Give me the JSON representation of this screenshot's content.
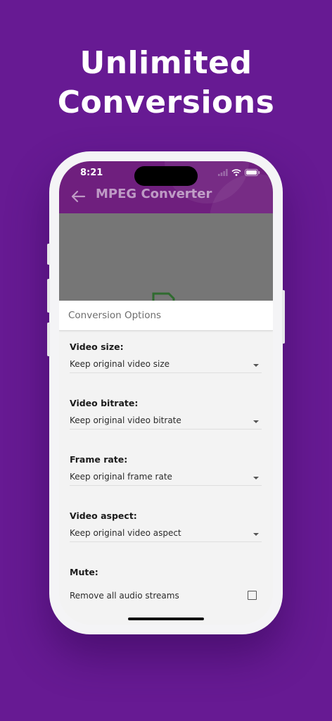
{
  "headline": {
    "line1": "Unlimited",
    "line2": "Conversions"
  },
  "status_bar": {
    "time": "8:21"
  },
  "app_bar": {
    "title": "MPEG Converter"
  },
  "sheet": {
    "title": "Conversion Options"
  },
  "options": [
    {
      "label": "Video size:",
      "value": "Keep original video size"
    },
    {
      "label": "Video bitrate:",
      "value": "Keep original video bitrate"
    },
    {
      "label": "Frame rate:",
      "value": "Keep original frame rate"
    },
    {
      "label": "Video aspect:",
      "value": "Keep original video aspect"
    }
  ],
  "mute": {
    "label": "Mute:",
    "option_text": "Remove all audio streams",
    "checked": false
  },
  "colors": {
    "background": "#671a93",
    "app_bar": "#6f1f7e",
    "overlay": "#767676",
    "sheet": "#f3f3f3"
  },
  "icons": [
    "back-arrow-icon",
    "wifi-icon",
    "battery-icon",
    "signal-icon",
    "chevron-down-icon",
    "checkbox-icon",
    "document-icon"
  ]
}
